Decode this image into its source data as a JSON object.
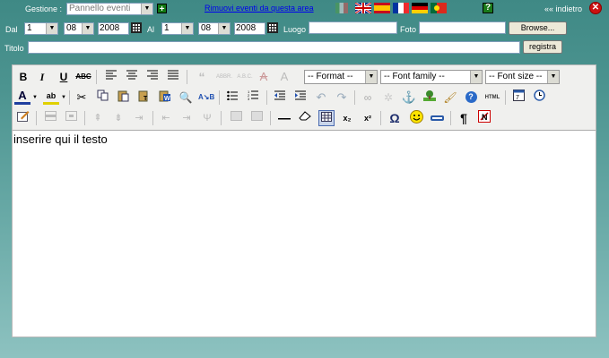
{
  "top": {
    "gestione_label": "Gestione :",
    "gestione_value": "Pannello eventi",
    "remove_link": "Rimuovi eventi da questa area",
    "back_label": "«« indietro",
    "help_icon": "?"
  },
  "date_row": {
    "dal_label": "Dal",
    "al_label": "Al",
    "from_day": "1",
    "from_month": "08",
    "from_year": "2008",
    "to_day": "1",
    "to_month": "08",
    "to_year": "2008",
    "luogo_label": "Luogo",
    "foto_label": "Foto",
    "browse_label": "Browse..."
  },
  "title_row": {
    "titolo_label": "Titolo",
    "register_label": "registra"
  },
  "toolbar": {
    "format_select": "-- Format --",
    "font_family_select": "-- Font family --",
    "font_size_select": "-- Font size --",
    "abbr_label": "ABBR.",
    "acronym_label": "A.B.C.",
    "html_label": "HTML",
    "strike_label": "ABC",
    "sub_label": "x₂",
    "sup_label": "x²"
  },
  "editor": {
    "content": "inserire qui il testo"
  },
  "colors": {
    "background_top": "#3f8985",
    "background_bottom": "#8dc2c0",
    "link": "#0000ee",
    "close": "#cc1111"
  }
}
